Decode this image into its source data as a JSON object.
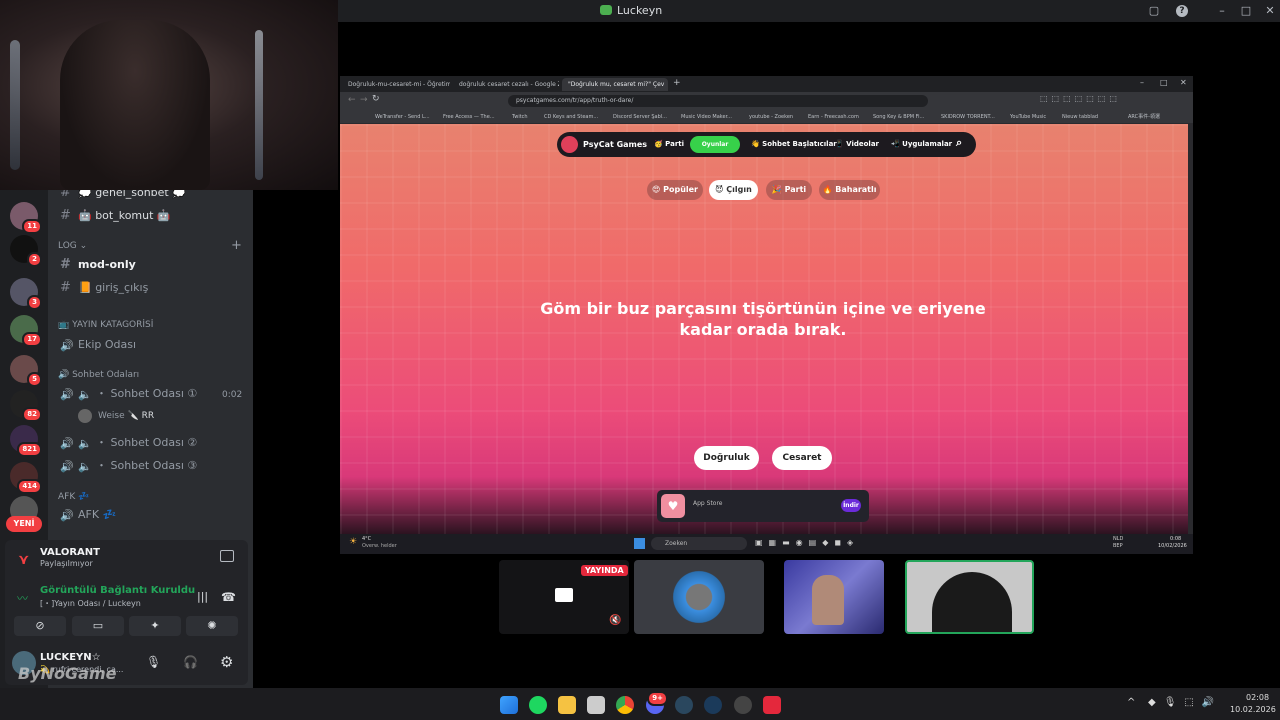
{
  "window": {
    "title": "Luckeyn"
  },
  "channels": {
    "items": [
      {
        "label": "💭 genel_sohbet 💭"
      },
      {
        "label": "🤖 bot_komut 🤖"
      }
    ],
    "log_category": "LOG",
    "mod_only": "mod-only",
    "giris": "📙 giriş_çıkış",
    "yayin_category": "📺 YAYIN KATAGORİSİ",
    "ekip": "Ekip Odası",
    "sohbet_category": "🔊 Sohbet Odaları",
    "sohbet1": "・ Sohbet Odası ①",
    "sohbet1_time": "0:02",
    "member": "Weise",
    "member_tag": "🔪 RR",
    "sohbet2": "・ Sohbet Odası ②",
    "sohbet3": "・ Sohbet Odası ③",
    "afk_category": "AFK 💤",
    "afk": "AFK 💤"
  },
  "rail": {
    "badges": [
      "11",
      "2",
      "3",
      "17",
      "5",
      "82",
      "821",
      "414"
    ],
    "new_label": "YENİ"
  },
  "voice": {
    "game": "VALORANT",
    "game_status": "Paylaşılmıyor",
    "connection": "Görüntülü Bağlantı Kuruldu",
    "channel": "[・]Yayın Odası / Luckeyn",
    "user": "LUCKEYN☆",
    "user_status": "💫 rufri cerendi, ca...",
    "watermark": "ByNoGame"
  },
  "browser": {
    "tabs": [
      "Doğruluk-mu-cesaret-mi - Öğretim",
      "doğruluk cesaret cezalı - Google Za",
      "\"Doğruluk mu, cesaret mi?\" Çev"
    ],
    "url": "psycatgames.com/tr/app/truth-or-dare/",
    "bookmarks": [
      "WeTransfer - Send L...",
      "Free Access — The...",
      "Twitch",
      "CD Keys and Steam...",
      "Discord Server Şabl...",
      "Music Video Maker...",
      "youtube - Zoeken",
      "Earn - Freecash.com",
      "Song Key & BPM Fi...",
      "SKIDROW TORRENT...",
      "YouTube Music",
      "Nieuw tabblad",
      "ARC事件-領選"
    ]
  },
  "site": {
    "brand": "PsyCat Games",
    "nav": [
      "Parti",
      "Oyunlar",
      "Sohbet Başlatıcılar",
      "Videolar",
      "Uygulamalar"
    ],
    "chips": [
      "Popüler",
      "Çılgın",
      "Parti",
      "Baharatlı"
    ],
    "question": "Göm bir buz parçasını tişörtünün içine ve eriyene kadar orada bırak.",
    "truth_button": "Doğruluk",
    "dare_button": "Cesaret",
    "app_store": "App Store",
    "download": "İndir"
  },
  "inner_taskbar": {
    "weather_temp": "4°C",
    "weather_desc": "Overw. helder",
    "search": "Zoeken",
    "lang": "NLD",
    "lang2": "BEP",
    "time": "0:08",
    "date": "10/02/2026"
  },
  "streams": {
    "live_badge": "YAYINDA"
  },
  "taskbar": {
    "time": "02:08",
    "date": "10.02.2026",
    "steam_badge": "9+"
  }
}
